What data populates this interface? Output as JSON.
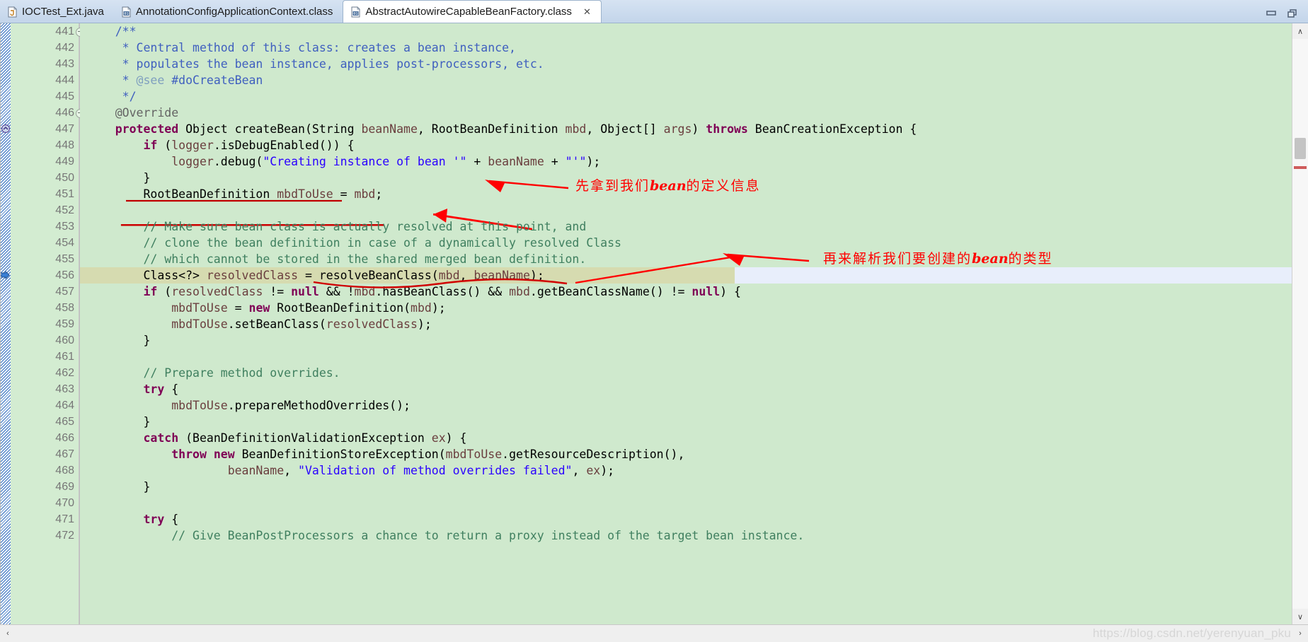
{
  "window": {
    "minimize_label": "Minimize",
    "restore_label": "Restore"
  },
  "tabs": [
    {
      "label": "IOCTest_Ext.java",
      "icon": "java-file-icon",
      "active": false,
      "closable": false
    },
    {
      "label": "AnnotationConfigApplicationContext.class",
      "icon": "class-file-icon",
      "active": false,
      "closable": false
    },
    {
      "label": "AbstractAutowireCapableBeanFactory.class",
      "icon": "class-file-icon",
      "active": true,
      "closable": true,
      "close_glyph": "✕"
    }
  ],
  "editor": {
    "first_line": 441,
    "highlight_line": 456,
    "lines": [
      {
        "n": 441,
        "fold": true,
        "marker": "",
        "tokens": [
          {
            "t": "    ",
            "c": "plain"
          },
          {
            "t": "/**",
            "c": "jdoc"
          }
        ]
      },
      {
        "n": 442,
        "fold": false,
        "marker": "",
        "tokens": [
          {
            "t": "     * Central method of this class: creates a bean instance,",
            "c": "jdoc"
          }
        ]
      },
      {
        "n": 443,
        "fold": false,
        "marker": "",
        "tokens": [
          {
            "t": "     * populates the bean instance, applies post-processors, etc.",
            "c": "jdoc"
          }
        ]
      },
      {
        "n": 444,
        "fold": false,
        "marker": "",
        "tokens": [
          {
            "t": "     * ",
            "c": "jdoc"
          },
          {
            "t": "@see",
            "c": "jdoctag"
          },
          {
            "t": " #doCreateBean",
            "c": "jdoc"
          }
        ]
      },
      {
        "n": 445,
        "fold": false,
        "marker": "",
        "tokens": [
          {
            "t": "     */",
            "c": "jdoc"
          }
        ]
      },
      {
        "n": 446,
        "fold": true,
        "marker": "",
        "tokens": [
          {
            "t": "    ",
            "c": "plain"
          },
          {
            "t": "@Override",
            "c": "ann"
          }
        ]
      },
      {
        "n": 447,
        "fold": false,
        "marker": "override",
        "tokens": [
          {
            "t": "    ",
            "c": "plain"
          },
          {
            "t": "protected",
            "c": "kw"
          },
          {
            "t": " Object createBean(String ",
            "c": "plain"
          },
          {
            "t": "beanName",
            "c": "param"
          },
          {
            "t": ", RootBeanDefinition ",
            "c": "plain"
          },
          {
            "t": "mbd",
            "c": "param"
          },
          {
            "t": ", Object[] ",
            "c": "plain"
          },
          {
            "t": "args",
            "c": "param"
          },
          {
            "t": ") ",
            "c": "plain"
          },
          {
            "t": "throws",
            "c": "kw"
          },
          {
            "t": " BeanCreationException {",
            "c": "plain"
          }
        ]
      },
      {
        "n": 448,
        "fold": false,
        "marker": "",
        "tokens": [
          {
            "t": "        ",
            "c": "plain"
          },
          {
            "t": "if",
            "c": "kw"
          },
          {
            "t": " (",
            "c": "plain"
          },
          {
            "t": "logger",
            "c": "param"
          },
          {
            "t": ".isDebugEnabled()) {",
            "c": "plain"
          }
        ]
      },
      {
        "n": 449,
        "fold": false,
        "marker": "",
        "tokens": [
          {
            "t": "            ",
            "c": "plain"
          },
          {
            "t": "logger",
            "c": "param"
          },
          {
            "t": ".debug(",
            "c": "plain"
          },
          {
            "t": "\"Creating instance of bean '\"",
            "c": "str"
          },
          {
            "t": " + ",
            "c": "plain"
          },
          {
            "t": "beanName",
            "c": "param"
          },
          {
            "t": " + ",
            "c": "plain"
          },
          {
            "t": "\"'\"",
            "c": "str"
          },
          {
            "t": ");",
            "c": "plain"
          }
        ]
      },
      {
        "n": 450,
        "fold": false,
        "marker": "",
        "tokens": [
          {
            "t": "        }",
            "c": "plain"
          }
        ]
      },
      {
        "n": 451,
        "fold": false,
        "marker": "",
        "tokens": [
          {
            "t": "        RootBeanDefinition ",
            "c": "plain"
          },
          {
            "t": "mbdToUse",
            "c": "param"
          },
          {
            "t": " = ",
            "c": "plain"
          },
          {
            "t": "mbd",
            "c": "param"
          },
          {
            "t": ";",
            "c": "plain"
          }
        ]
      },
      {
        "n": 452,
        "fold": false,
        "marker": "",
        "tokens": [
          {
            "t": "",
            "c": "plain"
          }
        ]
      },
      {
        "n": 453,
        "fold": false,
        "marker": "",
        "tokens": [
          {
            "t": "        // Make sure bean class is actually resolved at this point, and",
            "c": "cmt"
          }
        ]
      },
      {
        "n": 454,
        "fold": false,
        "marker": "",
        "tokens": [
          {
            "t": "        // clone the bean definition in case of a dynamically resolved Class",
            "c": "cmt"
          }
        ]
      },
      {
        "n": 455,
        "fold": false,
        "marker": "",
        "tokens": [
          {
            "t": "        // which cannot be stored in the shared merged bean definition.",
            "c": "cmt"
          }
        ]
      },
      {
        "n": 456,
        "fold": false,
        "marker": "arrow",
        "tokens": [
          {
            "t": "        Class<?> ",
            "c": "plain"
          },
          {
            "t": "resolvedClass",
            "c": "param"
          },
          {
            "t": " = resolveBeanClass(",
            "c": "plain"
          },
          {
            "t": "mbd",
            "c": "param"
          },
          {
            "t": ", ",
            "c": "plain"
          },
          {
            "t": "beanName",
            "c": "param"
          },
          {
            "t": ");",
            "c": "plain"
          }
        ]
      },
      {
        "n": 457,
        "fold": false,
        "marker": "",
        "tokens": [
          {
            "t": "        ",
            "c": "plain"
          },
          {
            "t": "if",
            "c": "kw"
          },
          {
            "t": " (",
            "c": "plain"
          },
          {
            "t": "resolvedClass",
            "c": "param"
          },
          {
            "t": " != ",
            "c": "plain"
          },
          {
            "t": "null",
            "c": "kw"
          },
          {
            "t": " && !",
            "c": "plain"
          },
          {
            "t": "mbd",
            "c": "param"
          },
          {
            "t": ".hasBeanClass() && ",
            "c": "plain"
          },
          {
            "t": "mbd",
            "c": "param"
          },
          {
            "t": ".getBeanClassName() != ",
            "c": "plain"
          },
          {
            "t": "null",
            "c": "kw"
          },
          {
            "t": ") {",
            "c": "plain"
          }
        ]
      },
      {
        "n": 458,
        "fold": false,
        "marker": "",
        "tokens": [
          {
            "t": "            ",
            "c": "plain"
          },
          {
            "t": "mbdToUse",
            "c": "param"
          },
          {
            "t": " = ",
            "c": "plain"
          },
          {
            "t": "new",
            "c": "kw"
          },
          {
            "t": " RootBeanDefinition(",
            "c": "plain"
          },
          {
            "t": "mbd",
            "c": "param"
          },
          {
            "t": ");",
            "c": "plain"
          }
        ]
      },
      {
        "n": 459,
        "fold": false,
        "marker": "",
        "tokens": [
          {
            "t": "            ",
            "c": "plain"
          },
          {
            "t": "mbdToUse",
            "c": "param"
          },
          {
            "t": ".setBeanClass(",
            "c": "plain"
          },
          {
            "t": "resolvedClass",
            "c": "param"
          },
          {
            "t": ");",
            "c": "plain"
          }
        ]
      },
      {
        "n": 460,
        "fold": false,
        "marker": "",
        "tokens": [
          {
            "t": "        }",
            "c": "plain"
          }
        ]
      },
      {
        "n": 461,
        "fold": false,
        "marker": "",
        "tokens": [
          {
            "t": "",
            "c": "plain"
          }
        ]
      },
      {
        "n": 462,
        "fold": false,
        "marker": "",
        "tokens": [
          {
            "t": "        // Prepare method overrides.",
            "c": "cmt"
          }
        ]
      },
      {
        "n": 463,
        "fold": false,
        "marker": "",
        "tokens": [
          {
            "t": "        ",
            "c": "plain"
          },
          {
            "t": "try",
            "c": "kw"
          },
          {
            "t": " {",
            "c": "plain"
          }
        ]
      },
      {
        "n": 464,
        "fold": false,
        "marker": "",
        "tokens": [
          {
            "t": "            ",
            "c": "plain"
          },
          {
            "t": "mbdToUse",
            "c": "param"
          },
          {
            "t": ".prepareMethodOverrides();",
            "c": "plain"
          }
        ]
      },
      {
        "n": 465,
        "fold": false,
        "marker": "",
        "tokens": [
          {
            "t": "        }",
            "c": "plain"
          }
        ]
      },
      {
        "n": 466,
        "fold": false,
        "marker": "",
        "tokens": [
          {
            "t": "        ",
            "c": "plain"
          },
          {
            "t": "catch",
            "c": "kw"
          },
          {
            "t": " (BeanDefinitionValidationException ",
            "c": "plain"
          },
          {
            "t": "ex",
            "c": "param"
          },
          {
            "t": ") {",
            "c": "plain"
          }
        ]
      },
      {
        "n": 467,
        "fold": false,
        "marker": "",
        "tokens": [
          {
            "t": "            ",
            "c": "plain"
          },
          {
            "t": "throw",
            "c": "kw"
          },
          {
            "t": " ",
            "c": "plain"
          },
          {
            "t": "new",
            "c": "kw"
          },
          {
            "t": " BeanDefinitionStoreException(",
            "c": "plain"
          },
          {
            "t": "mbdToUse",
            "c": "param"
          },
          {
            "t": ".getResourceDescription(),",
            "c": "plain"
          }
        ]
      },
      {
        "n": 468,
        "fold": false,
        "marker": "",
        "tokens": [
          {
            "t": "                    ",
            "c": "plain"
          },
          {
            "t": "beanName",
            "c": "param"
          },
          {
            "t": ", ",
            "c": "plain"
          },
          {
            "t": "\"Validation of method overrides failed\"",
            "c": "str"
          },
          {
            "t": ", ",
            "c": "plain"
          },
          {
            "t": "ex",
            "c": "param"
          },
          {
            "t": ");",
            "c": "plain"
          }
        ]
      },
      {
        "n": 469,
        "fold": false,
        "marker": "",
        "tokens": [
          {
            "t": "        }",
            "c": "plain"
          }
        ]
      },
      {
        "n": 470,
        "fold": false,
        "marker": "",
        "tokens": [
          {
            "t": "",
            "c": "plain"
          }
        ]
      },
      {
        "n": 471,
        "fold": false,
        "marker": "",
        "tokens": [
          {
            "t": "        ",
            "c": "plain"
          },
          {
            "t": "try",
            "c": "kw"
          },
          {
            "t": " {",
            "c": "plain"
          }
        ]
      },
      {
        "n": 472,
        "fold": false,
        "marker": "",
        "tokens": [
          {
            "t": "            // Give BeanPostProcessors a chance to return a proxy instead of the target bean instance.",
            "c": "cmt"
          }
        ]
      }
    ]
  },
  "annotations": [
    {
      "id": "note-1",
      "text_before": "先拿到我们",
      "text_em": "bean",
      "text_after": "的定义信息",
      "color": "#ff0000"
    },
    {
      "id": "note-2",
      "text_before": "再来解析我们要创建的",
      "text_em": "bean",
      "text_after": "的类型",
      "color": "#ff0000"
    }
  ],
  "scrollbar": {
    "up_glyph": "∧",
    "down_glyph": "∨",
    "left_glyph": "‹",
    "right_glyph": "›"
  },
  "watermark": {
    "text": "https://blog.csdn.net/yerenyuan_pku"
  },
  "colors": {
    "editor_bg": "#cfe9cd",
    "gutter_bg": "#d3ecd1",
    "tabbar_bg": "#cbdbee",
    "highlight_olive": "#d6dbb0",
    "highlight_blue": "#e8eefb",
    "annotation_red": "#ff0000",
    "keyword": "#7f0055",
    "string": "#2a00ff",
    "comment": "#3f7f5f",
    "javadoc": "#3f5fbf",
    "field": "#6a3e3e"
  }
}
